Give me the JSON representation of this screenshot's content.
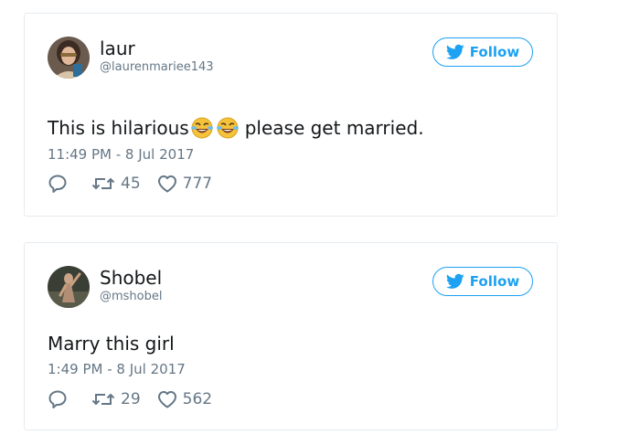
{
  "icons": {
    "reply": "reply-icon",
    "retweet": "retweet-icon",
    "like": "heart-icon",
    "follow": "twitter-bird-icon",
    "emoji": "face-with-tears-of-joy-emoji"
  },
  "colors": {
    "accent": "#1da1f2",
    "text": "#14171a",
    "muted": "#657786",
    "border": "#e6ecf0"
  },
  "tweets": [
    {
      "display_name": "laur",
      "handle": "@laurenmariee143",
      "follow_label": "Follow",
      "text_before_emoji": "This is hilarious",
      "text_after_emoji": "please get married.",
      "emoji_count": 2,
      "timestamp": "11:49 PM - 8 Jul 2017",
      "retweets": "45",
      "likes": "777"
    },
    {
      "display_name": "Shobel",
      "handle": "@mshobel",
      "follow_label": "Follow",
      "text": "Marry this girl",
      "timestamp": "1:49 PM - 8 Jul 2017",
      "retweets": "29",
      "likes": "562"
    }
  ]
}
